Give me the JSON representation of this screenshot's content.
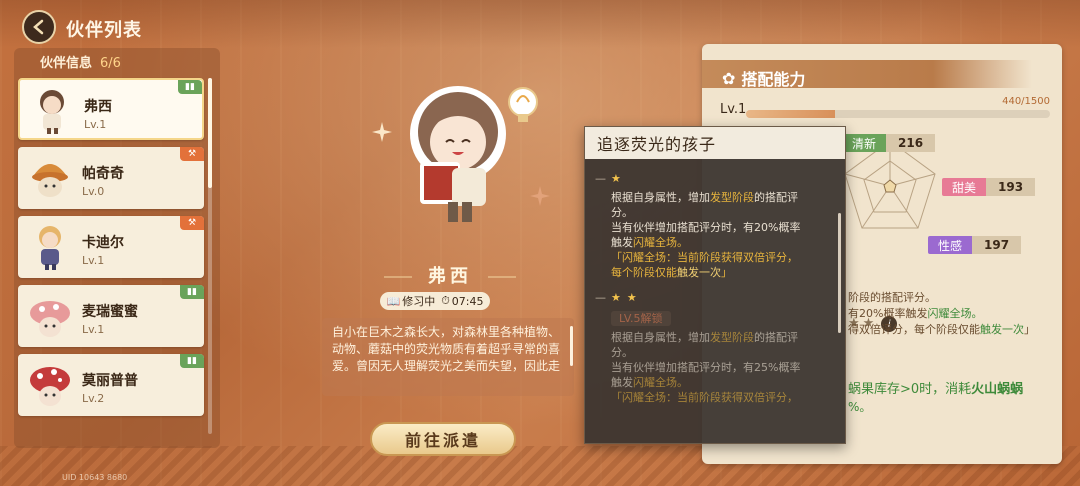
{
  "header": {
    "title": "伙伴列表"
  },
  "left": {
    "info_label": "伙伴信息",
    "info_count": "6/6",
    "partners": [
      {
        "name": "弗西",
        "level": "Lv.1",
        "tag": "book",
        "tag_color": "#6aa35a",
        "active": true
      },
      {
        "name": "帕奇奇",
        "level": "Lv.0",
        "tag": "hammer",
        "tag_color": "#e3713a",
        "active": false
      },
      {
        "name": "卡迪尔",
        "level": "Lv.1",
        "tag": "hammer",
        "tag_color": "#e3713a",
        "active": false
      },
      {
        "name": "麦瑞蜜蜜",
        "level": "Lv.1",
        "tag": "book",
        "tag_color": "#6aa35a",
        "active": false
      },
      {
        "name": "莫丽普普",
        "level": "Lv.2",
        "tag": "book",
        "tag_color": "#6aa35a",
        "active": false
      }
    ],
    "uid": "UID 10643 8680"
  },
  "center": {
    "name": "弗西",
    "status_label": "修习中",
    "status_time": "07:45",
    "description": "自小在巨木之森长大，对森林里各种植物、动物、蘑菇中的荧光物质有着超乎寻常的喜爱。曾因无人理解荧光之美而失望，因此走",
    "dispatch_label": "前往派遣"
  },
  "right": {
    "title": "搭配能力",
    "level": "Lv.1",
    "exp_text": "440/1500",
    "exp_fraction": 0.293,
    "stats": [
      {
        "label": "清新",
        "value": "216",
        "color": "#6aa35a"
      },
      {
        "label": "甜美",
        "value": "193",
        "color": "#e77a95"
      },
      {
        "label": "性感",
        "value": "197",
        "color": "#9b6ad0"
      }
    ],
    "text_line1": "阶段的搭配评分。",
    "text_line2a": "有20%概率触发",
    "text_line2b": "闪耀全场。",
    "text_line3a": "得双倍评分，每个阶段仅能",
    "text_line3b": "触发一次",
    "text_line3c": "」",
    "text_line4a": "蜗果库存>0时，消耗",
    "text_line4b": "火山蜗蜗",
    "text_line5": "%。"
  },
  "tooltip": {
    "title": "追逐荧光的孩子",
    "block1": {
      "line1a": "根据自身属性，增加",
      "line1b": "发型阶段",
      "line1c": "的搭配评",
      "line2": "分。",
      "line3": "当有伙伴增加搭配评分时，有20%概率",
      "line4a": "触发",
      "line4b": "闪耀全场。",
      "line5": "「闪耀全场：当前阶段获得双倍评分，",
      "line6a": "每个阶段仅能",
      "line6b": "触发一次",
      "line6c": "」"
    },
    "block2": {
      "lock": "LV.5解锁",
      "line1a": "根据自身属性，增加",
      "line1b": "发型阶段",
      "line1c": "的搭配评",
      "line2": "分。",
      "line3": "当有伙伴增加搭配评分时，有25%概率",
      "line4a": "触发",
      "line4b": "闪耀全场。",
      "line5": "「闪耀全场：当前阶段获得双倍评分，"
    }
  }
}
